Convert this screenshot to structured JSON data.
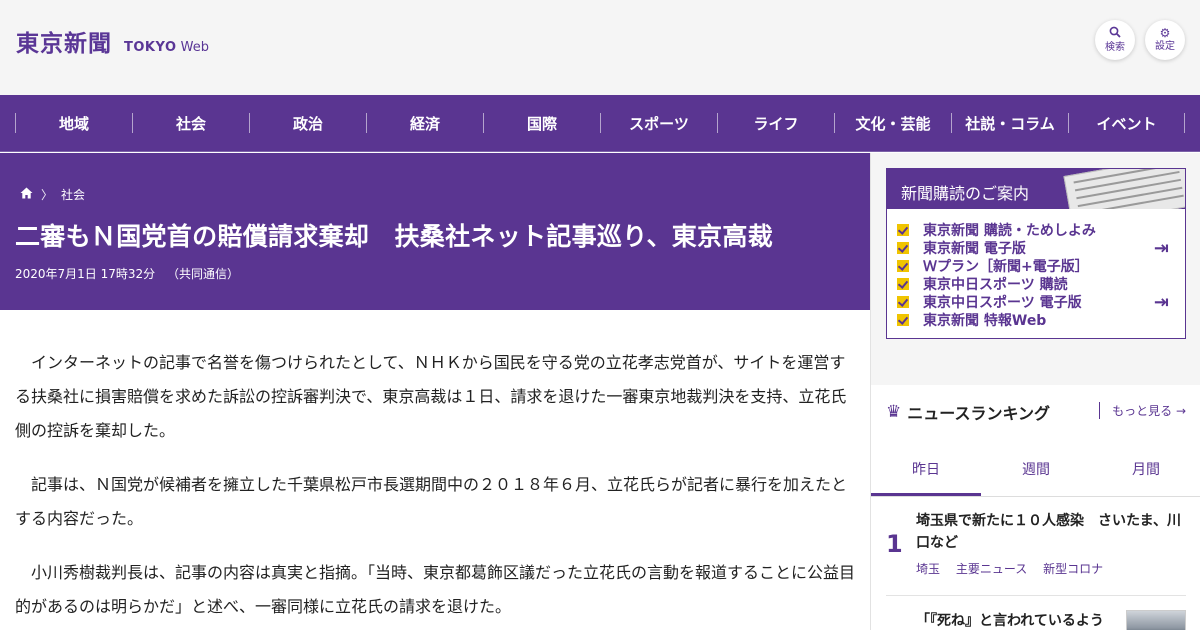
{
  "header": {
    "logo_jp": "東京新聞",
    "logo_en_bold": "TOKYO",
    "logo_en_light": "Web",
    "search_label": "検索",
    "settings_label": "設定"
  },
  "nav": {
    "items": [
      "地域",
      "社会",
      "政治",
      "経済",
      "国際",
      "スポーツ",
      "ライフ",
      "文化・芸能",
      "社説・コラム",
      "イベント"
    ]
  },
  "article": {
    "breadcrumb_category": "社会",
    "title": "二審もＮ国党首の賠償請求棄却　扶桑社ネット記事巡り、東京高裁",
    "date": "2020年7月1日 17時32分",
    "source": "（共同通信）",
    "paragraphs": [
      "インターネットの記事で名誉を傷つけられたとして、ＮＨＫから国民を守る党の立花孝志党首が、サイトを運営する扶桑社に損害賠償を求めた訴訟の控訴審判決で、東京高裁は１日、請求を退けた一審東京地裁判決を支持、立花氏側の控訴を棄却した。",
      "記事は、Ｎ国党が候補者を擁立した千葉県松戸市長選期間中の２０１８年６月、立花氏らが記者に暴行を加えたとする内容だった。",
      "小川秀樹裁判長は、記事の内容は真実と指摘。「当時、東京都葛飾区議だった立花氏の言動を報道することに公益目的があるのは明らかだ」と述べ、一審同様に立花氏の請求を退けた。"
    ]
  },
  "subscription": {
    "heading": "新聞購読のご案内",
    "items": [
      "東京新聞 購読・ためしよみ",
      "東京新聞 電子版",
      "Ｗプラン［新聞+電子版］",
      "東京中日スポーツ 購読",
      "東京中日スポーツ 電子版",
      "東京新聞 特報Web"
    ]
  },
  "ranking": {
    "heading": "ニュースランキング",
    "more_label": "もっと見る",
    "tabs": [
      "昨日",
      "週間",
      "月間"
    ],
    "active_tab": "昨日",
    "items": [
      {
        "rank": "1",
        "title": "埼玉県で新たに１０人感染　さいたま、川口など",
        "tags": [
          "埼玉",
          "主要ニュース",
          "新型コロナ"
        ]
      },
      {
        "title": "「『死ね』と言われているよう"
      }
    ]
  },
  "colors": {
    "brand_purple": "#5a3591",
    "check_yellow": "#f0c400",
    "header_bg": "#f5f5f5"
  }
}
